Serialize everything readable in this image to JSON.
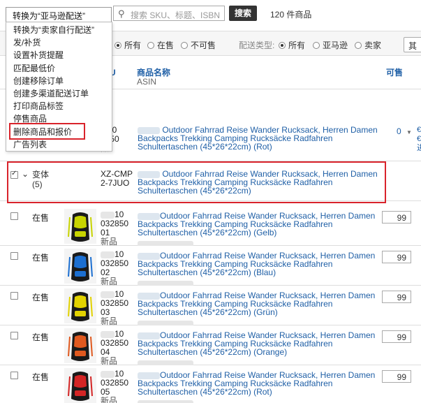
{
  "toolbar": {
    "bulk_action_value": "转换为“亚马逊配送”",
    "search_placeholder": "搜索 SKU、标题、ISBN",
    "search_button": "搜索",
    "result_count": "120 件商品"
  },
  "menu": {
    "items": [
      "转换为“卖家自行配送”",
      "发/补货",
      "设置补货提醒",
      "匹配最低价",
      "创建移除订单",
      "创建多渠道配送订单",
      "打印商品标签",
      "停售商品",
      "删除商品和报价",
      "广告列表"
    ]
  },
  "filters": {
    "status_options": [
      "所有",
      "在售",
      "不可售"
    ],
    "fulfillment_label": "配送类型:",
    "fulfillment_options": [
      "所有",
      "亚马逊",
      "卖家"
    ],
    "more_label": "其"
  },
  "columns": {
    "sku_fragment": "U",
    "product_name": "商品名称",
    "asin": "ASIN",
    "available": "可售"
  },
  "parent_row_above": {
    "sku_lines": [
      "M10",
      "2850",
      "品"
    ],
    "title": "Outdoor Fahrrad Reise Wander Rucksack, Herren Damen Backpacks Trekking Camping Rucksäcke Radfahren Schultertaschen (45*26*22cm) (Rot)",
    "available": "0",
    "side_glyphs": [
      "€",
      "€",
      "进"
    ]
  },
  "variation_row": {
    "label": "变体",
    "count": "(5)",
    "sku_lines": [
      "XZ-CMP",
      "2-7JUO"
    ],
    "title": "Outdoor Fahrrad Reise Wander Rucksack, Herren Damen Backpacks Trekking Camping Rucksäcke Radfahren Schultertaschen (45*26*22cm)"
  },
  "child_rows": [
    {
      "status": "在售",
      "sku": [
        "10",
        "032850",
        "01"
      ],
      "condition": "新品",
      "title": "Outdoor Fahrrad Reise Wander Rucksack, Herren Damen Backpacks Trekking Camping Rucksäcke Radfahren Schultertaschen (45*26*22cm) (Gelb)",
      "qty": "99",
      "accent": "#c8d400"
    },
    {
      "status": "在售",
      "sku": [
        "10",
        "032850",
        "02"
      ],
      "condition": "新品",
      "title": "Outdoor Fahrrad Reise Wander Rucksack, Herren Damen Backpacks Trekking Camping Rucksäcke Radfahren Schultertaschen (45*26*22cm) (Blau)",
      "qty": "99",
      "accent": "#1c6fd1"
    },
    {
      "status": "在售",
      "sku": [
        "10",
        "032850",
        "03"
      ],
      "condition": "新品",
      "title": "Outdoor Fahrrad Reise Wander Rucksack, Herren Damen Backpacks Trekking Camping Rucksäcke Radfahren Schultertaschen (45*26*22cm) (Grün)",
      "qty": "99",
      "accent": "#e2d200"
    },
    {
      "status": "在售",
      "sku": [
        "10",
        "032850",
        "04"
      ],
      "condition": "新品",
      "title": "Outdoor Fahrrad Reise Wander Rucksack, Herren Damen Backpacks Trekking Camping Rucksäcke Radfahren Schultertaschen (45*26*22cm) (Orange)",
      "qty": "99",
      "accent": "#e0591f"
    },
    {
      "status": "在售",
      "sku": [
        "10",
        "032850",
        "05"
      ],
      "condition": "新品",
      "title": "Outdoor Fahrrad Reise Wander Rucksack, Herren Damen Backpacks Trekking Camping Rucksäcke Radfahren Schultertaschen (45*26*22cm) (Rot)",
      "qty": "99",
      "accent": "#d42525"
    }
  ],
  "colors": {
    "link": "#1f5fa6",
    "highlight": "#d9232b",
    "search_button_bg": "#333333"
  }
}
